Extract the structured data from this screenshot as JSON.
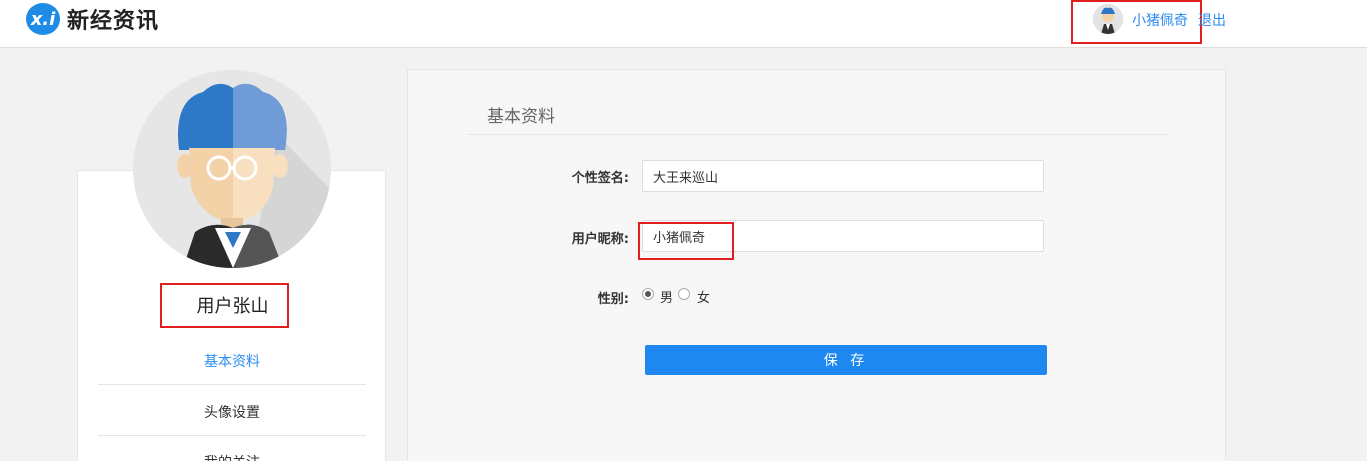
{
  "header": {
    "logo_mark": "x.i",
    "logo_text": "新经资讯",
    "user_name": "小猪佩奇",
    "logout": "退出"
  },
  "profile": {
    "username": "用户张山",
    "menu": [
      {
        "label": "基本资料",
        "active": true
      },
      {
        "label": "头像设置",
        "active": false
      },
      {
        "label": "我的关注",
        "active": false
      }
    ]
  },
  "form": {
    "title": "基本资料",
    "signature_label": "个性签名:",
    "signature_value": "大王来巡山",
    "nickname_label": "用户昵称:",
    "nickname_value": "小猪佩奇",
    "gender_label": "性别:",
    "gender_options": [
      {
        "label": "男",
        "checked": true
      },
      {
        "label": "女",
        "checked": false
      }
    ],
    "save_label": "保 存"
  },
  "colors": {
    "accent": "#1e88f0",
    "link": "#2d8cf0",
    "highlight": "#e02020"
  }
}
